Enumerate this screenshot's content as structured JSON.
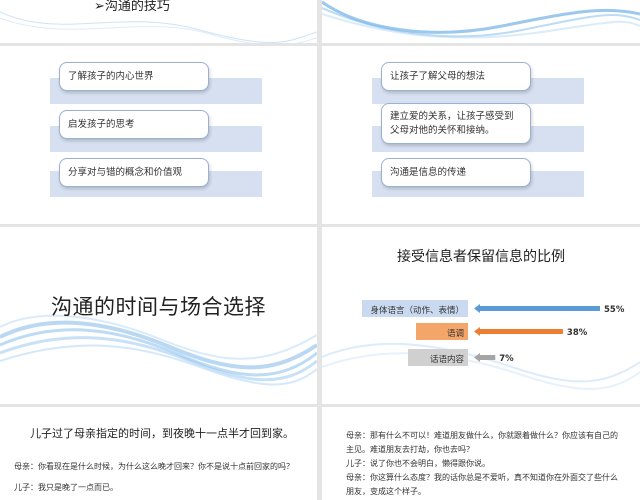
{
  "slide1": {
    "title": "➢沟通的技巧"
  },
  "slide3": {
    "items": [
      "了解孩子的内心世界",
      "启发孩子的思考",
      "分享对与错的概念和价值观"
    ]
  },
  "slide4": {
    "items": [
      "让孩子了解父母的想法",
      "建立爱的关系，让孩子感受到父母对他的关怀和接纳。",
      "沟通是信息的传递"
    ]
  },
  "slide5": {
    "title": "沟通的时间与场合选择"
  },
  "slide6": {
    "title": "接受信息者保留信息的比例"
  },
  "chart_data": {
    "type": "bar",
    "title": "接受信息者保留信息的比例",
    "categories": [
      "身体语言（动作、表情）",
      "语调",
      "话语内容"
    ],
    "values": [
      55,
      38,
      7
    ],
    "value_labels": [
      "55%",
      "38%",
      "7%"
    ],
    "colors": [
      "#5b9bd5",
      "#ed7d31",
      "#a5a5a5"
    ],
    "label_box_colors": [
      "#c9daf0",
      "#f4a56a",
      "#d0d0d0"
    ],
    "xlim": [
      0,
      100
    ]
  },
  "slide7": {
    "title": "儿子过了母亲指定的时间，到夜晚十一点半才回到家。",
    "lines": [
      "母亲：你看现在是什么时候，为什么这么晚才回来？你不是说十点前回家的吗？",
      "儿子：我只是晚了一点而已。"
    ]
  },
  "slide8": {
    "lines": [
      "母亲：那有什么不可以！难道朋友做什么，你就跟着做什么？你应该有自己的",
      "主见。难道朋友去打劫，你也去吗？",
      "儿子：说了你也不会明白，懒得跟你说。",
      "母亲：你这算什么态度？我的话你总是不爱听，真不知道你在外面交了些什么",
      "朋友，变成这个样子。"
    ]
  }
}
